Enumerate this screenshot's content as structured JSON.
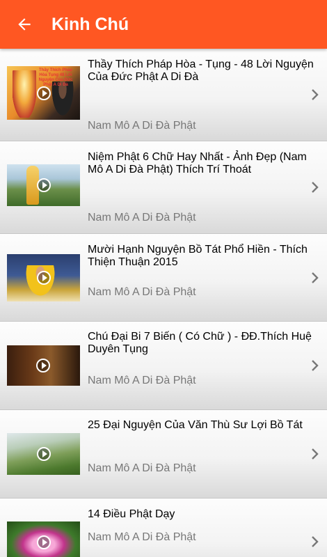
{
  "app": {
    "title": "Kinh Chú",
    "accent": "#ff5722"
  },
  "items": [
    {
      "title": "Thầy Thích Pháp Hòa - Tụng - 48 Lời Nguyện Của Đức Phật A Di Đà",
      "subtitle": "Nam Mô A Di Đà Phật",
      "thumb_caption": "Thầy Thích Pháp Hòa Tụng 48 Lời Nguyện Của Đức Phật A Di Đà"
    },
    {
      "title": "Niệm Phật 6 Chữ Hay Nhất - Ảnh Đẹp (Nam Mô A Di Đà Phật) Thích Trí Thoát",
      "subtitle": "Nam Mô A Di Đà Phật"
    },
    {
      "title": "Mười Hạnh Nguyện Bồ Tát Phổ Hiền - Thích Thiện Thuận 2015",
      "subtitle": "Nam Mô A Di Đà Phật"
    },
    {
      "title": "Chú Đại Bi 7 Biến ( Có Chữ ) - ĐĐ.Thích Huệ Duyên Tụng",
      "subtitle": "Nam Mô A Di Đà Phật"
    },
    {
      "title": "25 Đại Nguyện Của Văn Thù Sư Lợi Bồ Tát",
      "subtitle": "Nam Mô A Di Đà Phật"
    },
    {
      "title": "14 Điều Phật Dạy",
      "subtitle": "Nam Mô A Di Đà Phật"
    }
  ]
}
